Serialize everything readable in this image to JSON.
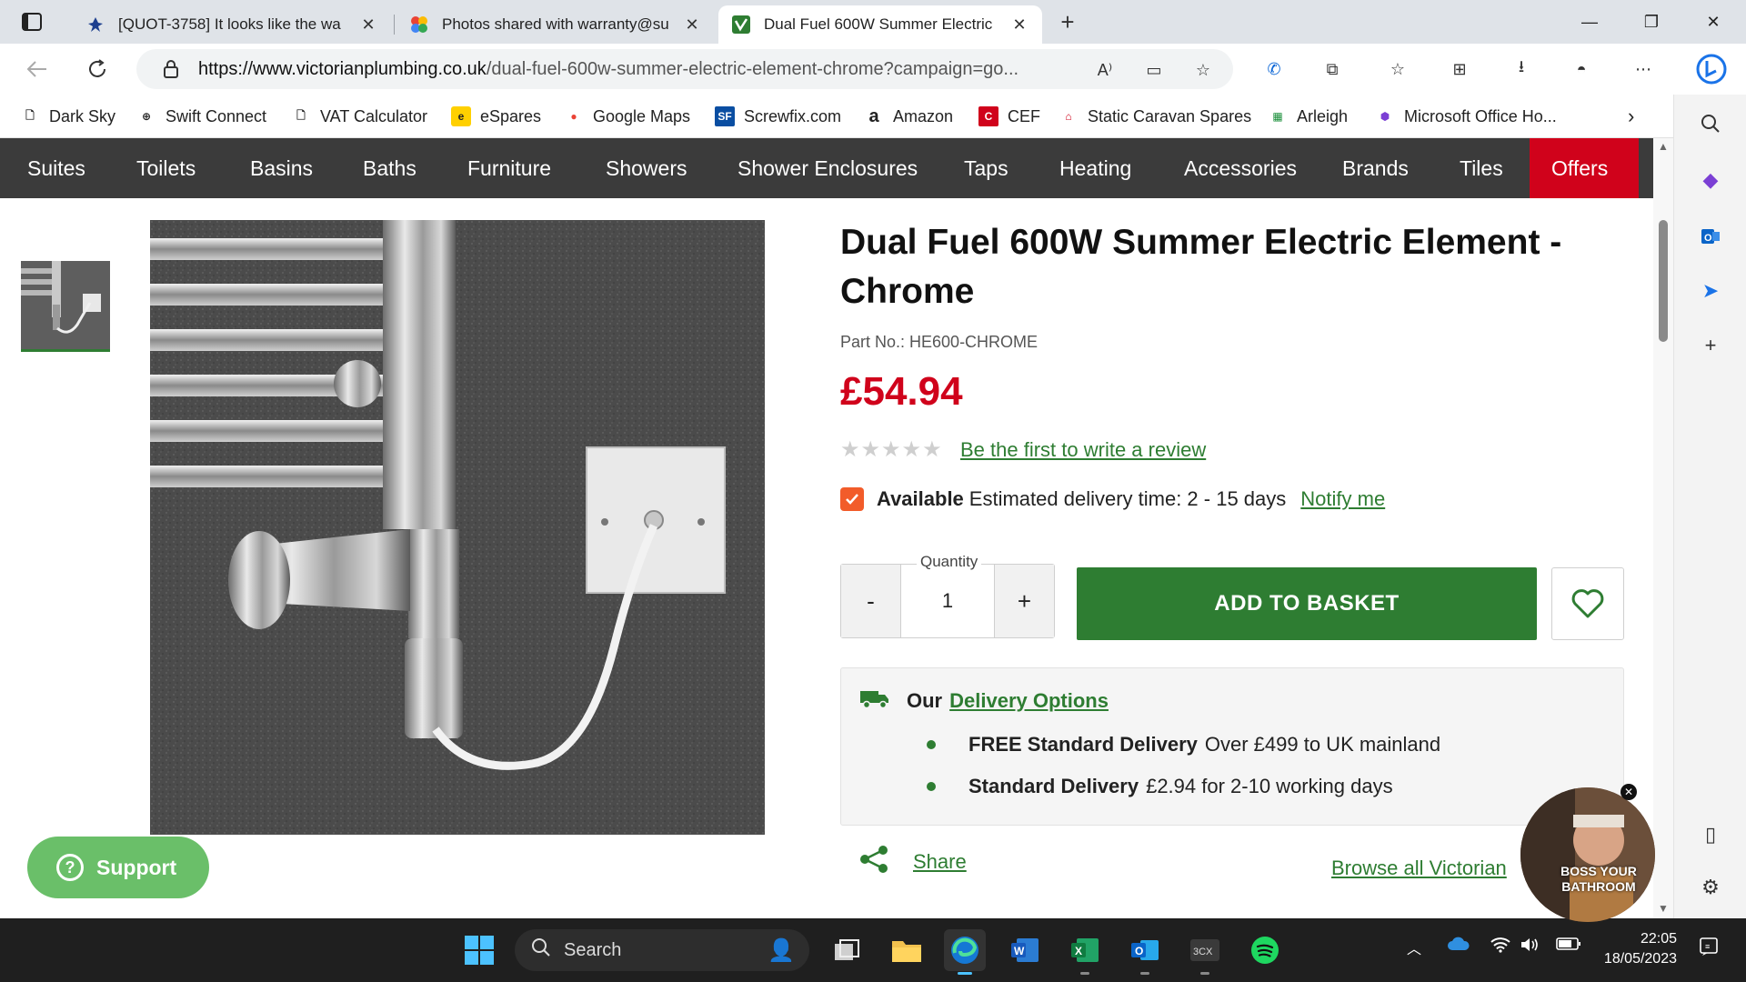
{
  "browser": {
    "tabs": [
      {
        "title": "[QUOT-3758] It looks like the wa",
        "icon": "jira-icon"
      },
      {
        "title": "Photos shared with warranty@su",
        "icon": "google-photos-icon"
      },
      {
        "title": "Dual Fuel 600W Summer Electric",
        "icon": "victorian-plumbing-icon"
      }
    ],
    "url_domain": "https://www.victorianplumbing.co.uk",
    "url_path": "/dual-fuel-600w-summer-electric-element-chrome?campaign=go...",
    "bookmarks": [
      {
        "label": "Dark Sky",
        "icon": "page-icon"
      },
      {
        "label": "Swift Connect",
        "icon": "globe-icon"
      },
      {
        "label": "VAT Calculator",
        "icon": "page-icon"
      },
      {
        "label": "eSpares",
        "icon": "espares-icon"
      },
      {
        "label": "Google Maps",
        "icon": "maps-pin-icon"
      },
      {
        "label": "Screwfix.com",
        "icon": "screwfix-icon"
      },
      {
        "label": "Amazon",
        "icon": "amazon-icon"
      },
      {
        "label": "CEF",
        "icon": "cef-icon"
      },
      {
        "label": "Static Caravan Spares",
        "icon": "caravan-icon"
      },
      {
        "label": "Arleigh",
        "icon": "arleigh-icon"
      },
      {
        "label": "Microsoft Office Ho...",
        "icon": "office-icon"
      }
    ]
  },
  "nav": {
    "categories": [
      "Suites",
      "Toilets",
      "Basins",
      "Baths",
      "Furniture",
      "Showers",
      "Shower Enclosures",
      "Taps",
      "Heating",
      "Accessories",
      "Brands",
      "Tiles"
    ],
    "offers": "Offers"
  },
  "product": {
    "title": "Dual Fuel 600W Summer Electric Element - Chrome",
    "part_no": "Part No.: HE600-CHROME",
    "price": "£54.94",
    "rating_stars": 0,
    "review_link": "Be the first to write a review",
    "availability_label": "Available",
    "delivery_estimate": "Estimated delivery time: 2 - 15 days",
    "notify_link": "Notify me",
    "quantity_label": "Quantity",
    "quantity_value": "1",
    "minus": "-",
    "plus": "+",
    "add_to_basket": "ADD TO BASKET"
  },
  "delivery": {
    "prefix": "Our",
    "link": "Delivery Options",
    "rows": [
      {
        "label": "FREE Standard Delivery",
        "detail": "Over £499 to UK mainland"
      },
      {
        "label": "Standard Delivery",
        "detail": "£2.94 for 2-10 working days"
      }
    ]
  },
  "share_label": "Share",
  "browse_link": "Browse all Victorian",
  "support_label": "Support",
  "video_overlay": "BOSS YOUR BATHROOM",
  "taskbar": {
    "search_placeholder": "Search",
    "time": "22:05",
    "date": "18/05/2023"
  },
  "colors": {
    "accent_green": "#2e7d32",
    "price_red": "#d0021b",
    "nav_dark": "#3b3b3b",
    "offers_red": "#d0021b",
    "support_green": "#6abf69"
  }
}
